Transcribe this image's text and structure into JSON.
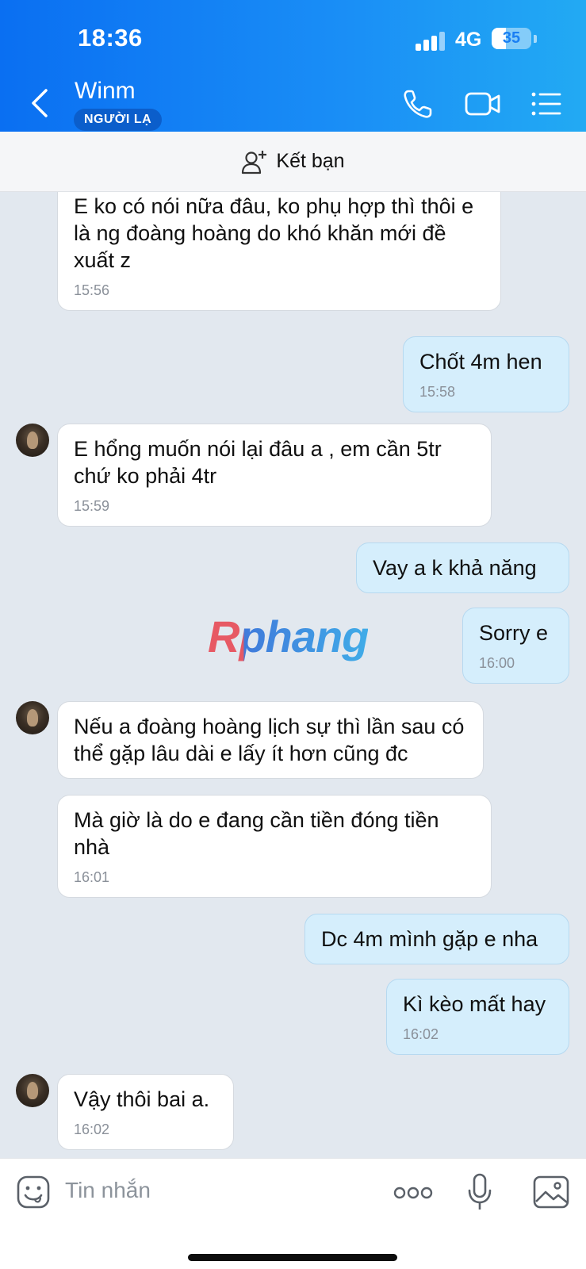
{
  "status_bar": {
    "time": "18:36",
    "network": "4G",
    "battery": "35",
    "battery_level": 0.35
  },
  "header": {
    "contact_name": "Winm",
    "badge": "NGƯỜI LẠ",
    "icons": [
      "back-chevron-icon",
      "phone-icon",
      "video-call-icon",
      "menu-list-icon"
    ]
  },
  "friend_bar": {
    "label": "Kết bạn",
    "icon": "add-user-icon"
  },
  "watermark": "Rphang",
  "messages": [
    {
      "dir": "in",
      "text": "E ko có nói nữa đâu, ko phụ hợp thì thôi e là ng đoàng hoàng do khó khăn mới đề xuất z",
      "time": "15:56"
    },
    {
      "dir": "out",
      "text": "Chốt 4m hen",
      "time": "15:58"
    },
    {
      "dir": "in",
      "text": "E hổng muốn nói lại đâu a , em cần 5tr chứ ko phải 4tr",
      "time": "15:59"
    },
    {
      "dir": "out",
      "text": "Vay a k khả năng",
      "time": ""
    },
    {
      "dir": "out",
      "text": "Sorry e",
      "time": "16:00"
    },
    {
      "dir": "in",
      "text": "Nếu a đoàng hoàng lịch sự thì lần sau có thể gặp lâu dài e lấy ít hơn cũng đc",
      "time": ""
    },
    {
      "dir": "in",
      "text": "Mà giờ là do e đang cần tiền đóng tiền nhà",
      "time": "16:01"
    },
    {
      "dir": "out",
      "text": "Dc 4m mình gặp e nha",
      "time": ""
    },
    {
      "dir": "out",
      "text": "Kì kèo mất hay",
      "time": "16:02"
    },
    {
      "dir": "in",
      "text": "Vậy thôi bai a.",
      "time": "16:02"
    }
  ],
  "input_bar": {
    "placeholder": "Tin nhắn",
    "icons": [
      "sticker-icon",
      "more-icon",
      "microphone-icon",
      "image-icon"
    ]
  }
}
